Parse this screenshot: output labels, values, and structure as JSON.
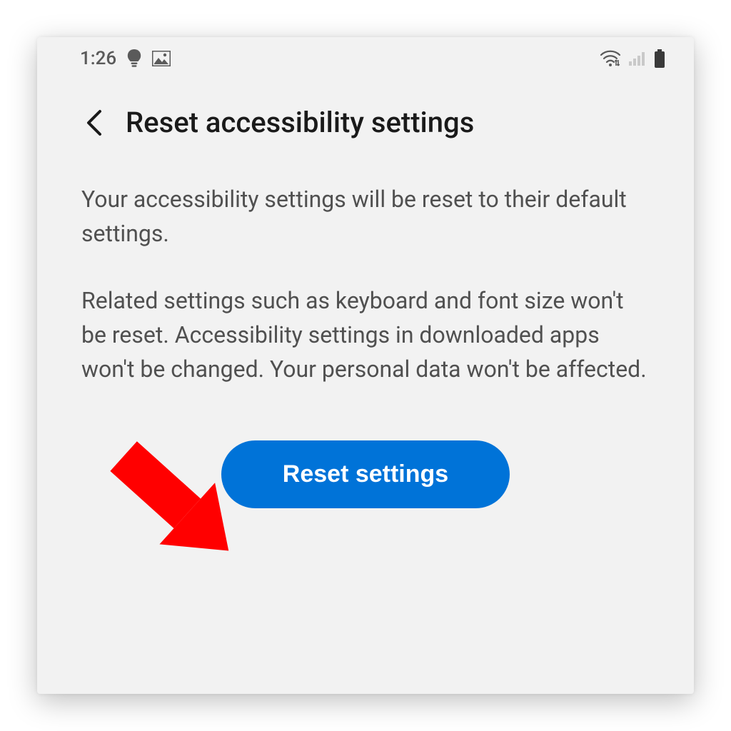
{
  "status_bar": {
    "time": "1:26"
  },
  "header": {
    "title": "Reset accessibility settings"
  },
  "body": {
    "paragraph1": "Your accessibility settings will be reset to their default settings.",
    "paragraph2": "Related settings such as keyboard and font size won't be reset. Accessibility settings in downloaded apps won't be changed. Your personal data won't be affected."
  },
  "button": {
    "reset_label": "Reset settings"
  },
  "colors": {
    "primary": "#0073d8",
    "annotation": "#ff0000"
  }
}
